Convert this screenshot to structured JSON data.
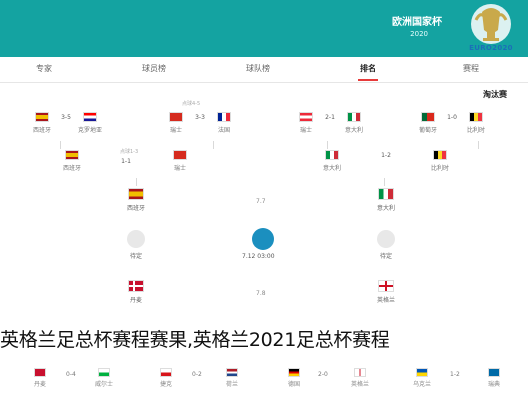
{
  "header": {
    "title": "欧洲国家杯",
    "subtitle": "2020",
    "logo_text": "EURO2020",
    "logo_icon": "euro-trophy-logo",
    "color": "#14a3a1"
  },
  "tabs": [
    {
      "label": "赛程",
      "active": false
    },
    {
      "label": "排名",
      "active": true
    },
    {
      "label": "球队榜",
      "active": false
    },
    {
      "label": "球员榜",
      "active": false
    },
    {
      "label": "专家",
      "active": false
    }
  ],
  "section_label": "淘汰赛",
  "round1": [
    {
      "left": {
        "name": "比利时",
        "flag": "belgium"
      },
      "score": "1-0",
      "right": {
        "name": "葡萄牙",
        "flag": "portugal"
      }
    },
    {
      "left": {
        "name": "意大利",
        "flag": "italy"
      },
      "score": "2-1",
      "right": {
        "name": "奥地利",
        "flag": "austria"
      }
    },
    {
      "left": {
        "name": "法国",
        "flag": "france"
      },
      "score": "3-3",
      "right": {
        "name": "瑞士",
        "flag": "switzerland"
      },
      "note": "点球4-5"
    },
    {
      "left": {
        "name": "克罗地亚",
        "flag": "croatia"
      },
      "score": "3-5",
      "right": {
        "name": "西班牙",
        "flag": "spain"
      }
    }
  ],
  "quarter": [
    {
      "left": {
        "name": "比利时",
        "flag": "belgium"
      },
      "score": "1-2",
      "right": {
        "name": "意大利",
        "flag": "italy"
      }
    },
    {
      "left": {
        "name": "瑞士",
        "flag": "switzerland"
      },
      "score": "1-1",
      "right": {
        "name": "西班牙",
        "flag": "spain"
      },
      "note": "点球1-3"
    }
  ],
  "semi": {
    "right": {
      "name": "意大利",
      "flag": "italy"
    },
    "left": {
      "name": "西班牙",
      "flag": "spain"
    },
    "date": "7.7"
  },
  "final": {
    "right": {
      "name": "待定"
    },
    "left": {
      "name": "待定"
    },
    "time": "7.12 03:00"
  },
  "lower_semi": {
    "right": {
      "name": "英格兰",
      "flag": "england"
    },
    "left": {
      "name": "丹麦",
      "flag": "denmark"
    },
    "date": "7.8"
  },
  "bottom": [
    {
      "name": "瑞典",
      "flag": "sweden"
    },
    {
      "score": "1-2"
    },
    {
      "name": "乌克兰",
      "flag": "ukraine"
    },
    {
      "name": "英格兰",
      "flag": "england"
    },
    {
      "score": "2-0"
    },
    {
      "name": "德国",
      "flag": "germany"
    },
    {
      "name": "荷兰",
      "flag": "netherlands"
    },
    {
      "score": "0-2"
    },
    {
      "name": "捷克",
      "flag": "czech"
    },
    {
      "name": "威尔士",
      "flag": "wales"
    },
    {
      "score": "0-4"
    },
    {
      "name": "丹麦",
      "flag": "denmark"
    }
  ],
  "caption": "英格兰足总杯赛程赛果,英格兰2021足总杯赛程"
}
